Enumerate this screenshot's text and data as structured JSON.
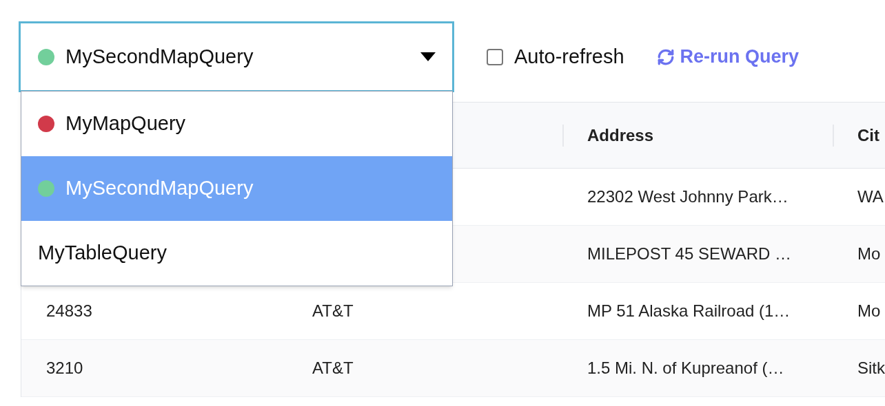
{
  "query_select": {
    "value": "MySecondMapQuery",
    "color": "#72cf9b",
    "expanded": true
  },
  "options": [
    {
      "label": "MyMapQuery",
      "color": "#d13a4a",
      "selected": false
    },
    {
      "label": "MySecondMapQuery",
      "color": "#72cf9b",
      "selected": true
    },
    {
      "label": "MyTableQuery",
      "selected": false
    }
  ],
  "auto_refresh": {
    "label": "Auto-refresh",
    "checked": false
  },
  "rerun_button": {
    "label": "Re-run Query"
  },
  "table": {
    "columns": [
      null,
      null,
      "Address",
      "Cit"
    ],
    "rows": [
      [
        null,
        null,
        "22302 West Johnny Park…",
        "WA"
      ],
      [
        null,
        null,
        "MILEPOST 45 SEWARD …",
        "Mo"
      ],
      [
        "24833",
        "AT&T",
        "MP 51 Alaska Railroad (1…",
        "Mo"
      ],
      [
        "3210",
        "AT&T",
        "1.5 Mi. N. of Kupreanof (…",
        "Sitk"
      ]
    ]
  }
}
